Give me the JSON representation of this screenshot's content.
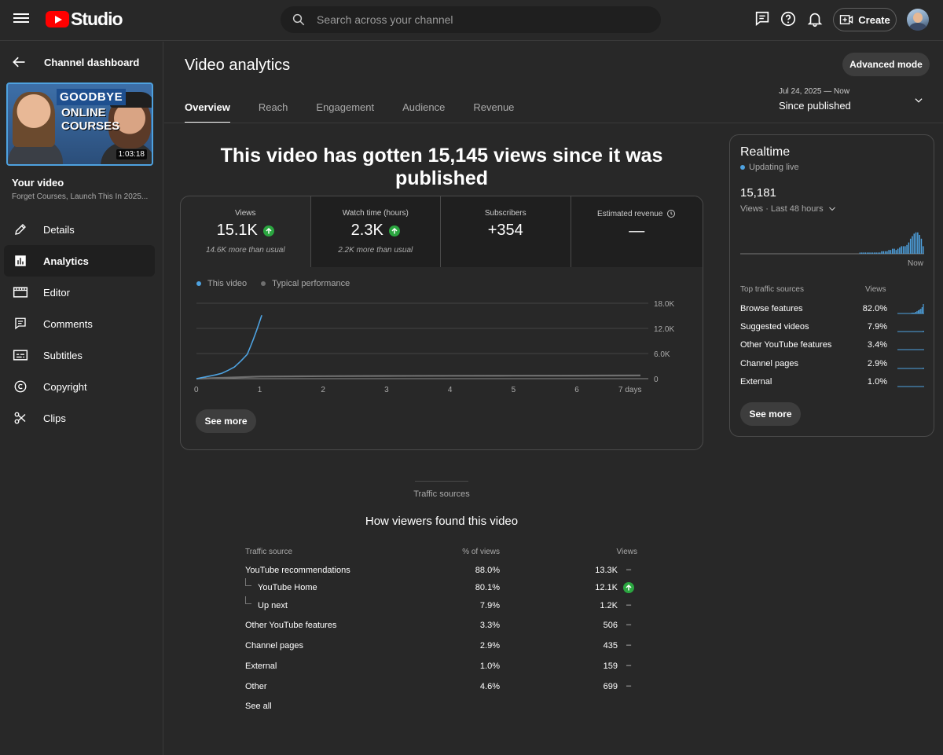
{
  "header": {
    "logo_text": "Studio",
    "search_placeholder": "Search across your channel",
    "create_label": "Create"
  },
  "sidebar": {
    "back_label": "Channel dashboard",
    "thumbnail": {
      "overlay_line1": "GOODBYE",
      "overlay_line2": "ONLINE COURSES",
      "duration": "1:03:18"
    },
    "your_video_label": "Your video",
    "video_title": "Forget Courses, Launch This In 2025...",
    "items": [
      {
        "label": "Details",
        "icon": "pencil-icon"
      },
      {
        "label": "Analytics",
        "icon": "analytics-icon",
        "active": true
      },
      {
        "label": "Editor",
        "icon": "editor-icon"
      },
      {
        "label": "Comments",
        "icon": "comments-icon"
      },
      {
        "label": "Subtitles",
        "icon": "subtitles-icon"
      },
      {
        "label": "Copyright",
        "icon": "copyright-icon"
      },
      {
        "label": "Clips",
        "icon": "scissors-icon"
      }
    ]
  },
  "main": {
    "title": "Video analytics",
    "advanced_mode_label": "Advanced mode",
    "tabs": [
      "Overview",
      "Reach",
      "Engagement",
      "Audience",
      "Revenue"
    ],
    "active_tab": "Overview",
    "date_range": {
      "range": "Jul 24, 2025 — Now",
      "label": "Since published"
    },
    "headline": "This video has gotten 15,145 views since it was published",
    "metrics": [
      {
        "label": "Views",
        "value": "15.1K",
        "trend": "up",
        "note": "14.6K more than usual"
      },
      {
        "label": "Watch time (hours)",
        "value": "2.3K",
        "trend": "up",
        "note": "2.2K more than usual"
      },
      {
        "label": "Subscribers",
        "value": "+354",
        "trend": "",
        "note": ""
      },
      {
        "label": "Estimated revenue",
        "value": "—",
        "trend": "",
        "note": ""
      }
    ],
    "legend": [
      "This video",
      "Typical performance"
    ],
    "see_more_label": "See more",
    "colors": {
      "this_video": "#4ea2e0",
      "typical": "#6f6f6f",
      "up": "#2ba640"
    }
  },
  "chart_data": {
    "type": "line",
    "xlabel": "",
    "ylabel": "",
    "x_ticks": [
      "0",
      "1",
      "2",
      "3",
      "4",
      "5",
      "6",
      "7 days"
    ],
    "y_ticks": [
      "18.0K",
      "12.0K",
      "6.0K",
      "0"
    ],
    "ylim": [
      0,
      18000
    ],
    "xlim": [
      0,
      7
    ],
    "grid": true,
    "series": [
      {
        "name": "This video",
        "x": [
          0,
          0.1,
          0.2,
          0.3,
          0.4,
          0.5,
          0.6,
          0.7,
          0.8,
          0.85,
          0.9,
          0.95,
          1.0,
          1.03
        ],
        "values": [
          0,
          300,
          600,
          900,
          1300,
          2000,
          2800,
          4200,
          5800,
          7600,
          9500,
          11600,
          13800,
          15145
        ]
      },
      {
        "name": "Typical performance",
        "x": [
          0,
          1,
          2,
          3,
          4,
          5,
          6,
          7
        ],
        "values": [
          0,
          500,
          600,
          650,
          700,
          720,
          740,
          760
        ]
      }
    ]
  },
  "realtime": {
    "title": "Realtime",
    "status": "Updating live",
    "count": "15,181",
    "period_label": "Views · Last 48 hours",
    "now_label": "Now",
    "bars": [
      0,
      0,
      0,
      0,
      0,
      0,
      0,
      0,
      0,
      0,
      0,
      0,
      0,
      0,
      0,
      0,
      0,
      0,
      0,
      0,
      0,
      0,
      0,
      0,
      0,
      0,
      0,
      0,
      0,
      0,
      0,
      0,
      0,
      0,
      0,
      0,
      0,
      0,
      0,
      0,
      0,
      0,
      0,
      0,
      0,
      0,
      0,
      0,
      0,
      0,
      0,
      0,
      0,
      0,
      0,
      0,
      0,
      0,
      0,
      0,
      0,
      0,
      0,
      0,
      0,
      0,
      1,
      1,
      1,
      1,
      1,
      1,
      1,
      1,
      1,
      1,
      1,
      1,
      2,
      2,
      2,
      2,
      3,
      3,
      4,
      4,
      3,
      4,
      5,
      6,
      6,
      6,
      7,
      9,
      12,
      14,
      16,
      17,
      17,
      15,
      12,
      6
    ],
    "traffic_header": "Top traffic sources",
    "views_header": "Views",
    "sources": [
      {
        "name": "Browse features",
        "value": "82.0%"
      },
      {
        "name": "Suggested videos",
        "value": "7.9%"
      },
      {
        "name": "Other YouTube features",
        "value": "3.4%"
      },
      {
        "name": "Channel pages",
        "value": "2.9%"
      },
      {
        "name": "External",
        "value": "1.0%"
      }
    ],
    "see_more_label": "See more"
  },
  "traffic": {
    "section_label": "Traffic sources",
    "title": "How viewers found this video",
    "headers": {
      "source": "Traffic source",
      "pct": "% of views",
      "views": "Views"
    },
    "rows": [
      {
        "name": "YouTube recommendations",
        "pct": "88.0%",
        "views": "13.3K",
        "trend": "–",
        "level": 0
      },
      {
        "name": "YouTube Home",
        "pct": "80.1%",
        "views": "12.1K",
        "trend": "up",
        "level": 1
      },
      {
        "name": "Up next",
        "pct": "7.9%",
        "views": "1.2K",
        "trend": "–",
        "level": 1
      },
      {
        "name": "Other YouTube features",
        "pct": "3.3%",
        "views": "506",
        "trend": "–",
        "level": 0
      },
      {
        "name": "Channel pages",
        "pct": "2.9%",
        "views": "435",
        "trend": "–",
        "level": 0
      },
      {
        "name": "External",
        "pct": "1.0%",
        "views": "159",
        "trend": "–",
        "level": 0
      },
      {
        "name": "Other",
        "pct": "4.6%",
        "views": "699",
        "trend": "–",
        "level": 0
      }
    ],
    "see_all_label": "See all"
  }
}
